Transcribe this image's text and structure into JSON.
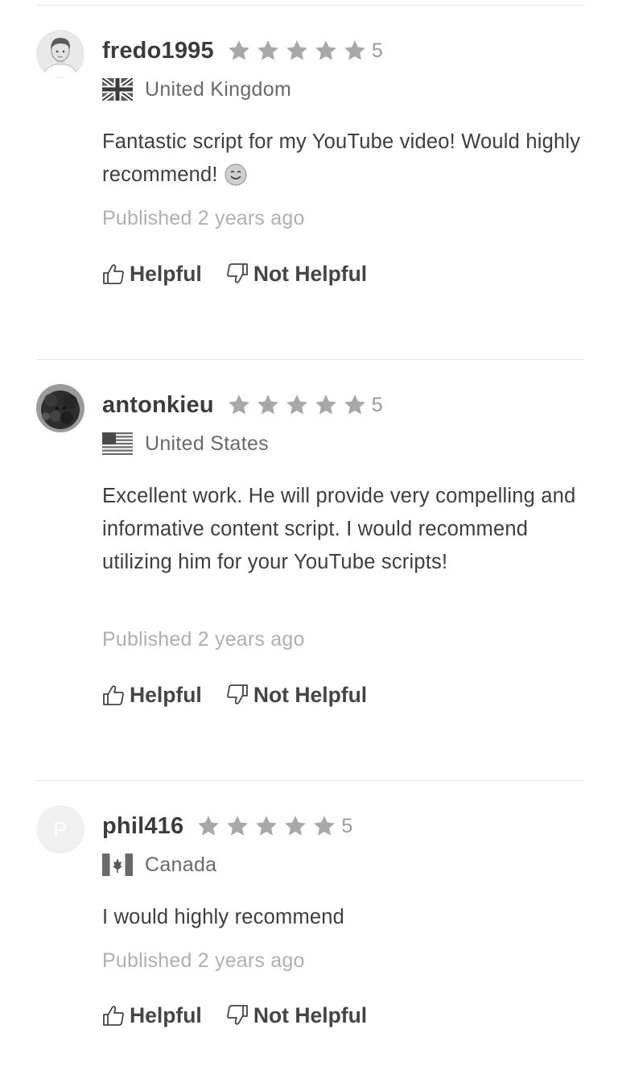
{
  "reviews": [
    {
      "username": "fredo1995",
      "rating": "5",
      "country": "United Kingdom",
      "flag_icon": "uk-flag-icon",
      "text": "Fantastic script for my YouTube video! Would highly recommend!",
      "emoji_icon": "smiling-face-icon",
      "published": "Published 2 years ago",
      "helpful_label": "Helpful",
      "not_helpful_label": "Not Helpful"
    },
    {
      "username": "antonkieu",
      "rating": "5",
      "country": "United States",
      "flag_icon": "us-flag-icon",
      "text": "Excellent work. He will provide very compelling and informative content script. I would recommend utilizing him for your YouTube scripts!",
      "published": "Published 2 years ago",
      "helpful_label": "Helpful",
      "not_helpful_label": "Not Helpful"
    },
    {
      "username": "phil416",
      "rating": "5",
      "avatar_letter": "P",
      "country": "Canada",
      "flag_icon": "canada-flag-icon",
      "text": "I would highly recommend",
      "published": "Published 2 years ago",
      "helpful_label": "Helpful",
      "not_helpful_label": "Not Helpful"
    }
  ],
  "colors": {
    "star": "#a8a8a8",
    "text": "#3e3e3e",
    "muted": "#b0b0b0",
    "divider": "#e6e6e6"
  }
}
